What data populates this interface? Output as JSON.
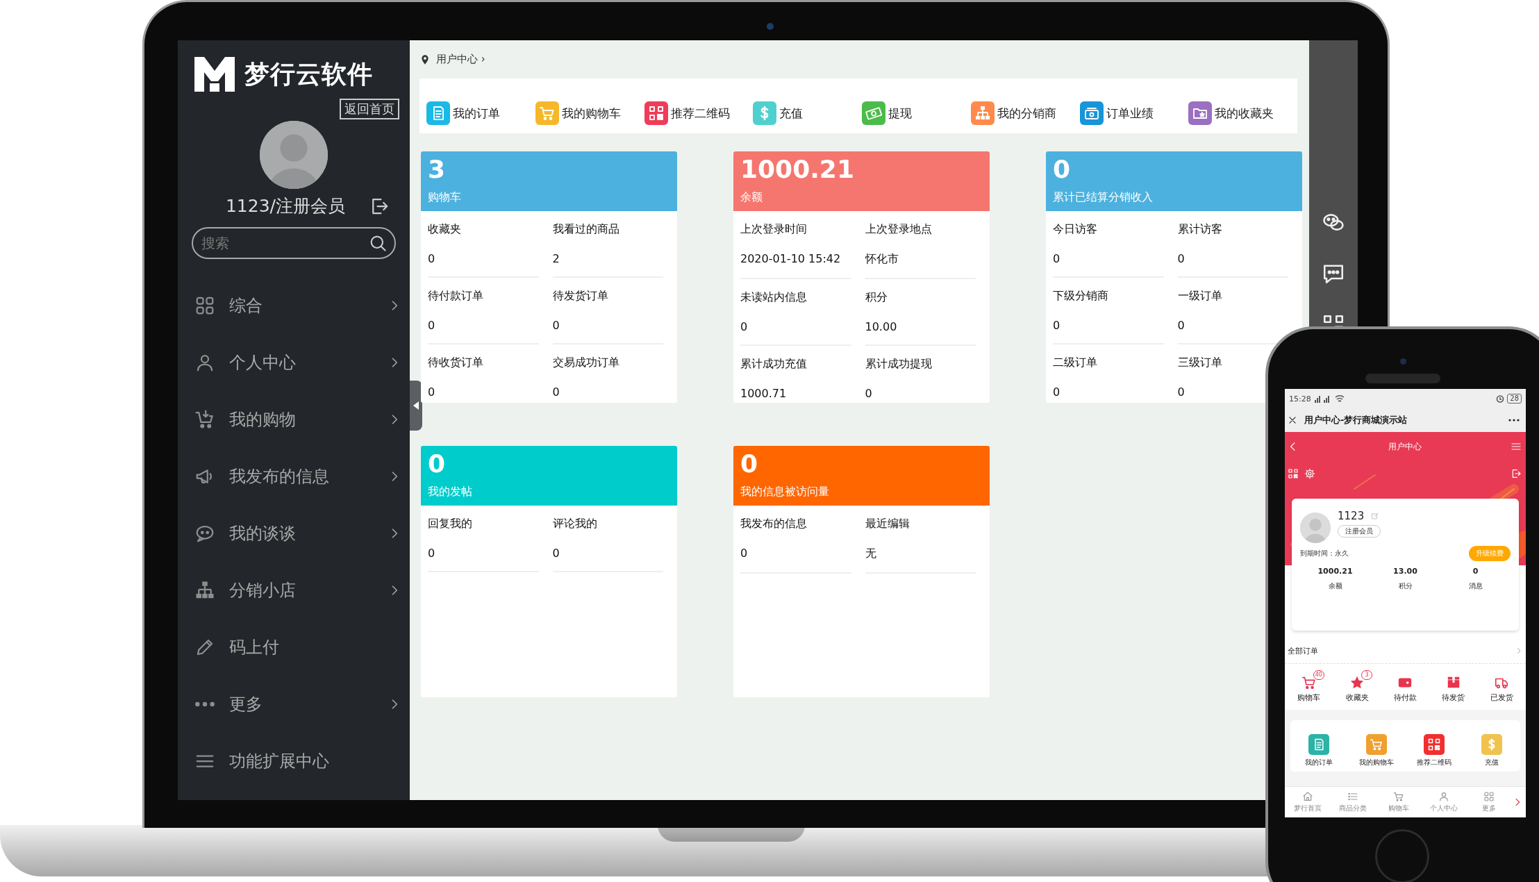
{
  "sidebar": {
    "logo_text": "梦行云软件",
    "home_link": "返回首页",
    "user": "1123/注册会员",
    "search": {
      "placeholder": "搜索"
    },
    "items": [
      {
        "label": "综合",
        "kind": "grid",
        "arrow": true
      },
      {
        "label": "个人中心",
        "kind": "person",
        "arrow": true
      },
      {
        "label": "我的购物",
        "kind": "cartdl",
        "arrow": true
      },
      {
        "label": "我发布的信息",
        "kind": "megaphone",
        "arrow": true
      },
      {
        "label": "我的谈谈",
        "kind": "chat",
        "arrow": true
      },
      {
        "label": "分销小店",
        "kind": "org",
        "arrow": true
      },
      {
        "label": "码上付",
        "kind": "pen",
        "arrow": false
      },
      {
        "label": "更多",
        "kind": "dots",
        "arrow": true
      },
      {
        "label": "功能扩展中心",
        "kind": "menu",
        "arrow": false
      }
    ]
  },
  "breadcrumb": "用户中心 ›",
  "shortcuts": [
    {
      "label": "我的订单",
      "kind": "receipt",
      "color": "#1ab9e6"
    },
    {
      "label": "我的购物车",
      "kind": "cart",
      "color": "#f5b82a"
    },
    {
      "label": "推荐二维码",
      "kind": "qr",
      "color": "#ee3c5a"
    },
    {
      "label": "充值",
      "kind": "dollar",
      "color": "#4fd0cf"
    },
    {
      "label": "提现",
      "kind": "banknote",
      "color": "#4cbb4a"
    },
    {
      "label": "我的分销商",
      "kind": "org",
      "color": "#ff8a4c"
    },
    {
      "label": "订单业绩",
      "kind": "ticket",
      "color": "#1894db"
    },
    {
      "label": "我的收藏夹",
      "kind": "folder",
      "color": "#9b70c0"
    }
  ],
  "cards": [
    {
      "value": "3",
      "title": "购物车",
      "color": "#4cb1de",
      "fields": [
        {
          "label": "收藏夹",
          "value": "0"
        },
        {
          "label": "我看过的商品",
          "value": "2"
        },
        {
          "label": "待付款订单",
          "value": "0"
        },
        {
          "label": "待发货订单",
          "value": "0"
        },
        {
          "label": "待收货订单",
          "value": "0"
        },
        {
          "label": "交易成功订单",
          "value": "0"
        }
      ]
    },
    {
      "value": "1000.21",
      "title": "余额",
      "color": "#f5766e",
      "fields": [
        {
          "label": "上次登录时间",
          "value": "2020-01-10 15:42"
        },
        {
          "label": "上次登录地点",
          "value": "怀化市"
        },
        {
          "label": "未读站内信息",
          "value": "0"
        },
        {
          "label": "积分",
          "value": "10.00"
        },
        {
          "label": "累计成功充值",
          "value": "1000.71"
        },
        {
          "label": "累计成功提现",
          "value": "0"
        }
      ]
    },
    {
      "value": "0",
      "title": "累计已结算分销收入",
      "color": "#4cb1de",
      "fields": [
        {
          "label": "今日访客",
          "value": "0"
        },
        {
          "label": "累计访客",
          "value": "0"
        },
        {
          "label": "下级分销商",
          "value": "0"
        },
        {
          "label": "一级订单",
          "value": "0"
        },
        {
          "label": "二级订单",
          "value": "0"
        },
        {
          "label": "三级订单",
          "value": "0"
        }
      ]
    },
    {
      "value": "0",
      "title": "我的发帖",
      "color": "#00cccc",
      "fields": [
        {
          "label": "回复我的",
          "value": "0"
        },
        {
          "label": "评论我的",
          "value": "0"
        }
      ]
    },
    {
      "value": "0",
      "title": "我的信息被访问量",
      "color": "#ff6600",
      "fields": [
        {
          "label": "我发布的信息",
          "value": "0"
        },
        {
          "label": "最近编辑",
          "value": "无"
        }
      ]
    }
  ],
  "phone": {
    "time": "15:28",
    "battery": "28",
    "title": "用户中心-梦行商城演示站",
    "header": "用户中心",
    "user": "1123",
    "member": "注册会员",
    "expiry": "到期时间：永久",
    "upgrade": "升级续费",
    "stats": [
      {
        "value": "1000.21",
        "label": "余额"
      },
      {
        "value": "13.00",
        "label": "积分"
      },
      {
        "value": "0",
        "label": "消息"
      }
    ],
    "orders_title": "全部订单",
    "orders": [
      {
        "label": "购物车",
        "kind": "cart",
        "badge": "40"
      },
      {
        "label": "收藏夹",
        "kind": "star",
        "badge": "3"
      },
      {
        "label": "待付款",
        "kind": "wallet"
      },
      {
        "label": "待发货",
        "kind": "box"
      },
      {
        "label": "已发货",
        "kind": "truck"
      }
    ],
    "shortcuts": [
      {
        "label": "我的订单",
        "kind": "receipt",
        "color": "#2bb3a6"
      },
      {
        "label": "我的购物车",
        "kind": "cart",
        "color": "#f0a02e"
      },
      {
        "label": "推荐二维码",
        "kind": "qr",
        "color": "#f22e2e"
      },
      {
        "label": "充值",
        "kind": "dollar",
        "color": "#f0c24e"
      }
    ],
    "nav": [
      {
        "label": "梦行首页",
        "kind": "home"
      },
      {
        "label": "商品分类",
        "kind": "list"
      },
      {
        "label": "购物车",
        "kind": "cart"
      },
      {
        "label": "个人中心",
        "kind": "person"
      },
      {
        "label": "更多",
        "kind": "grid"
      }
    ]
  }
}
